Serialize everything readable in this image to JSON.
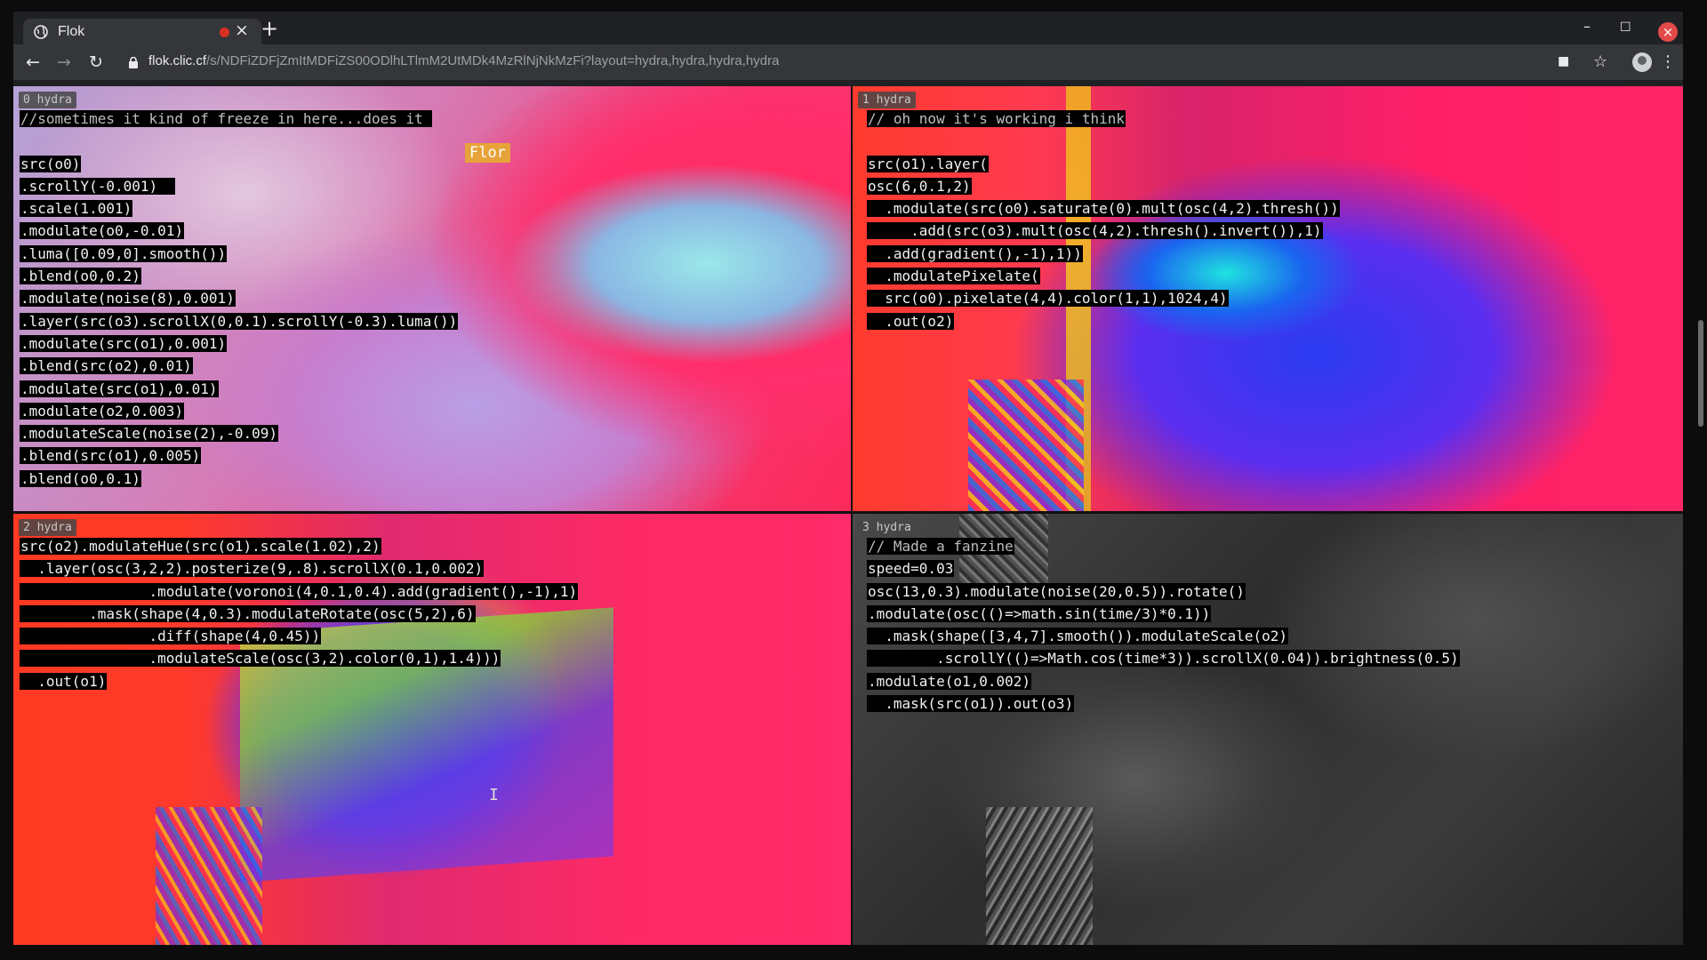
{
  "browser": {
    "tab_title": "Flok",
    "tab_close": "×",
    "new_tab": "+",
    "minimize": "–",
    "maximize": "☐",
    "close": "×",
    "url_host": "flok.clic.cf",
    "url_path": "/s/NDFiZDFjZmItMDFiZS00ODlhLTlmM2UtMDk4MzRlNjNkMzFi?layout=hydra,hydra,hydra,hydra",
    "back": "←",
    "forward": "→",
    "reload": "↻",
    "camera_icon": "■",
    "star_icon": "☆",
    "menu_icon": "⋮"
  },
  "panes": [
    {
      "label": "0 hydra",
      "lines": [
        "//sometimes it kind of freeze in here...does it ",
        "",
        "src(o0)",
        ".scrollY(-0.001)  ",
        ".scale(1.001)",
        ".modulate(o0,-0.01)",
        ".luma([0.09,0].smooth())",
        ".blend(o0,0.2)",
        ".modulate(noise(8),0.001)",
        ".layer(src(o3).scrollX(0,0.1).scrollY(-0.3).luma())",
        ".modulate(src(o1),0.001)",
        ".blend(src(o2),0.01)",
        ".modulate(src(o1),0.01)",
        ".modulate(o2,0.003)",
        ".modulateScale(noise(2),-0.09)",
        ".blend(src(o1),0.005)",
        ".blend(o0,0.1)"
      ]
    },
    {
      "label": "1 hydra",
      "lines": [
        "// oh now it's working i think",
        "",
        "src(o1).layer(",
        "osc(6,0.1,2)",
        "  .modulate(src(o0).saturate(0).mult(osc(4,2).thresh())",
        "     .add(src(o3).mult(osc(4,2).thresh().invert()),1)",
        "  .add(gradient(),-1),1))",
        "  .modulatePixelate(",
        "  src(o0).pixelate(4,4).color(1,1),1024,4)",
        "  .out(o2)"
      ]
    },
    {
      "label": "2 hydra",
      "lines": [
        "src(o2).modulateHue(src(o1).scale(1.02),2)",
        "  .layer(osc(3,2,2).posterize(9,.8).scrollX(0.1,0.002)",
        "               .modulate(voronoi(4,0.1,0.4).add(gradient(),-1),1)",
        "        .mask(shape(4,0.3).modulateRotate(osc(5,2),6)",
        "               .diff(shape(4,0.45))",
        "               .modulateScale(osc(3,2).color(0,1),1.4)))",
        "  .out(o1)"
      ]
    },
    {
      "label": "3 hydra",
      "lines": [
        "// Made a fanzine",
        "speed=0.03",
        "osc(13,0.3).modulate(noise(20,0.5)).rotate()",
        ".modulate(osc(()=>math.sin(time/3)*0.1))",
        "  .mask(shape([3,4,7].smooth()).modulateScale(o2)",
        "        .scrollY(()=>Math.cos(time*3)).scrollX(0.04)).brightness(0.5)",
        ".modulate(o1,0.002)",
        "  .mask(src(o1)).out(o3)"
      ]
    }
  ],
  "remote_cursor": "Flor",
  "text_cursor": "I"
}
